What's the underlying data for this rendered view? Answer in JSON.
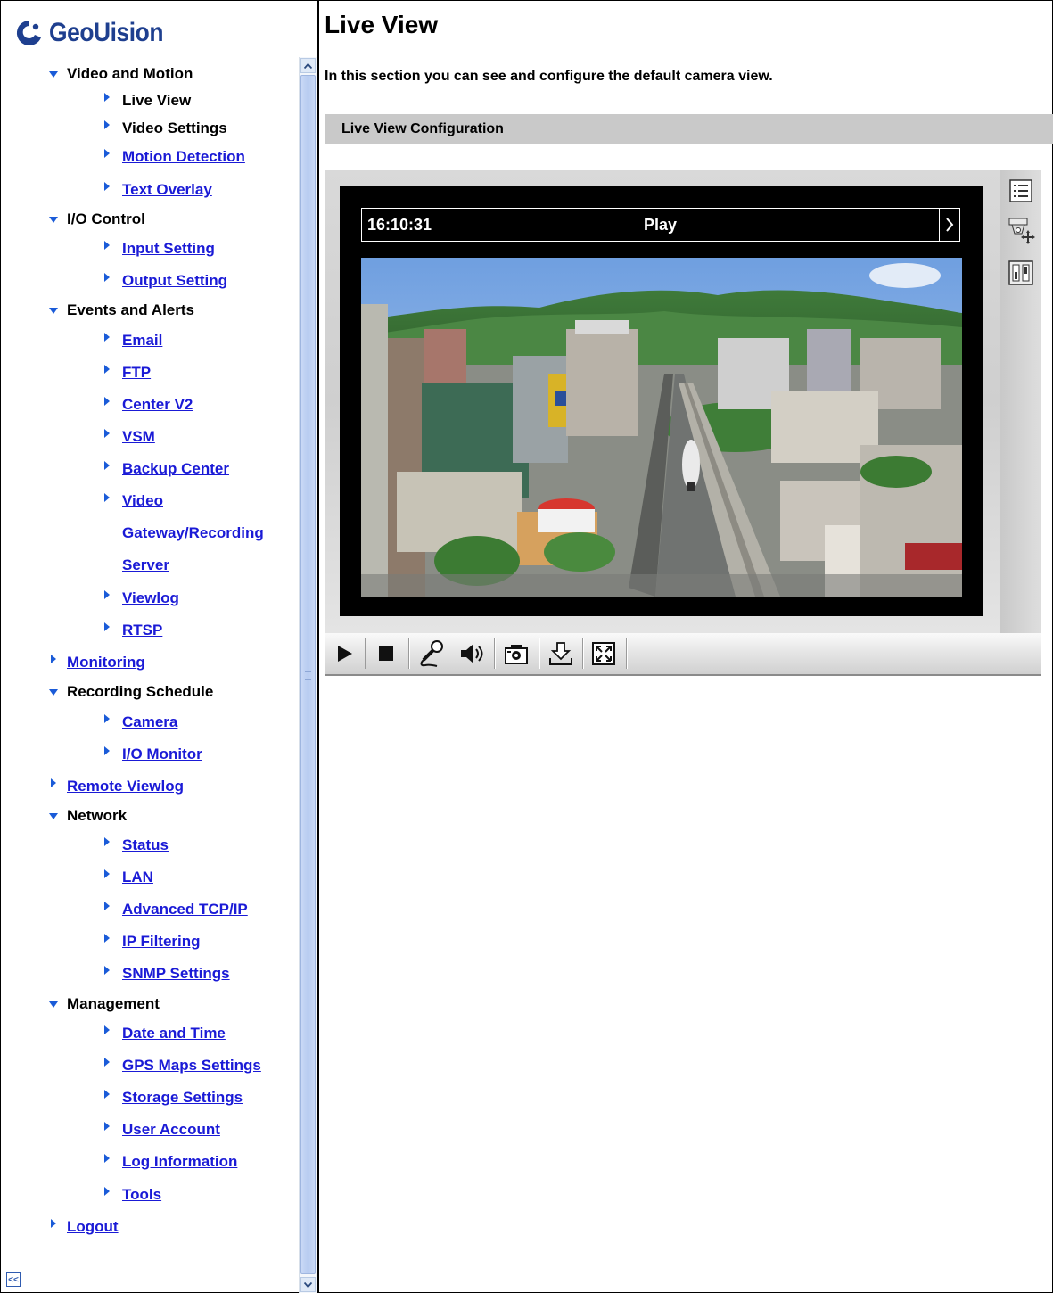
{
  "brand": {
    "name": "GeoUision"
  },
  "sidebar": {
    "items": [
      {
        "label": "Video and Motion",
        "level": 0,
        "expanded": true,
        "link": false
      },
      {
        "label": "Live View",
        "level": 1,
        "link": false
      },
      {
        "label": "Video Settings",
        "level": 1,
        "link": false
      },
      {
        "label": "Motion Detection",
        "level": 1,
        "link": true
      },
      {
        "label": "Text Overlay",
        "level": 1,
        "link": true
      },
      {
        "label": "I/O Control",
        "level": 0,
        "expanded": true,
        "link": false
      },
      {
        "label": "Input Setting",
        "level": 1,
        "link": true
      },
      {
        "label": "Output Setting",
        "level": 1,
        "link": true
      },
      {
        "label": "Events and Alerts",
        "level": 0,
        "expanded": true,
        "link": false
      },
      {
        "label": "Email",
        "level": 1,
        "link": true
      },
      {
        "label": "FTP",
        "level": 1,
        "link": true
      },
      {
        "label": "Center V2",
        "level": 1,
        "link": true
      },
      {
        "label": "VSM",
        "level": 1,
        "link": true
      },
      {
        "label": "Backup Center",
        "level": 1,
        "link": true
      },
      {
        "label": "Video",
        "level": 1,
        "link": true
      },
      {
        "label": "Gateway/Recording",
        "level": 1,
        "link": true,
        "continuation": true
      },
      {
        "label": "Server",
        "level": 1,
        "link": true,
        "continuation": true
      },
      {
        "label": "Viewlog",
        "level": 1,
        "link": true
      },
      {
        "label": "RTSP",
        "level": 1,
        "link": true
      },
      {
        "label": "Monitoring",
        "level": 0,
        "expanded": false,
        "link": true
      },
      {
        "label": "Recording Schedule",
        "level": 0,
        "expanded": true,
        "link": false
      },
      {
        "label": "Camera",
        "level": 1,
        "link": true
      },
      {
        "label": "I/O Monitor",
        "level": 1,
        "link": true
      },
      {
        "label": "Remote Viewlog",
        "level": 0,
        "expanded": false,
        "link": true
      },
      {
        "label": "Network",
        "level": 0,
        "expanded": true,
        "link": false
      },
      {
        "label": "Status",
        "level": 1,
        "link": true
      },
      {
        "label": "LAN",
        "level": 1,
        "link": true
      },
      {
        "label": "Advanced TCP/IP",
        "level": 1,
        "link": true
      },
      {
        "label": "IP Filtering",
        "level": 1,
        "link": true
      },
      {
        "label": "SNMP Settings",
        "level": 1,
        "link": true
      },
      {
        "label": "Management",
        "level": 0,
        "expanded": true,
        "link": false
      },
      {
        "label": "Date and Time",
        "level": 1,
        "link": true
      },
      {
        "label": "GPS Maps Settings",
        "level": 1,
        "link": true
      },
      {
        "label": "Storage Settings",
        "level": 1,
        "link": true
      },
      {
        "label": "User Account",
        "level": 1,
        "link": true
      },
      {
        "label": "Log Information",
        "level": 1,
        "link": true
      },
      {
        "label": "Tools",
        "level": 1,
        "link": true
      },
      {
        "label": "Logout",
        "level": 0,
        "expanded": false,
        "link": true
      }
    ],
    "collapse_label": "<<"
  },
  "main": {
    "title": "Live View",
    "description": "In this section you can see and configure the default camera view.",
    "section_title": "Live View Configuration"
  },
  "player": {
    "osd_time": "16:10:31",
    "osd_status": "Play",
    "side_tools": [
      "list-icon",
      "ptz-camera-icon",
      "io-panel-icon"
    ],
    "controls": [
      "play-icon",
      "stop-icon",
      "microphone-icon",
      "speaker-icon",
      "snapshot-icon",
      "download-icon",
      "fullscreen-icon"
    ]
  },
  "colors": {
    "link": "#1a1ad6",
    "caret": "#1a5bd8",
    "brand": "#1e3f8f",
    "section_bar": "#c9c9c9",
    "scrollbar_thumb": "#b7cbf0"
  }
}
